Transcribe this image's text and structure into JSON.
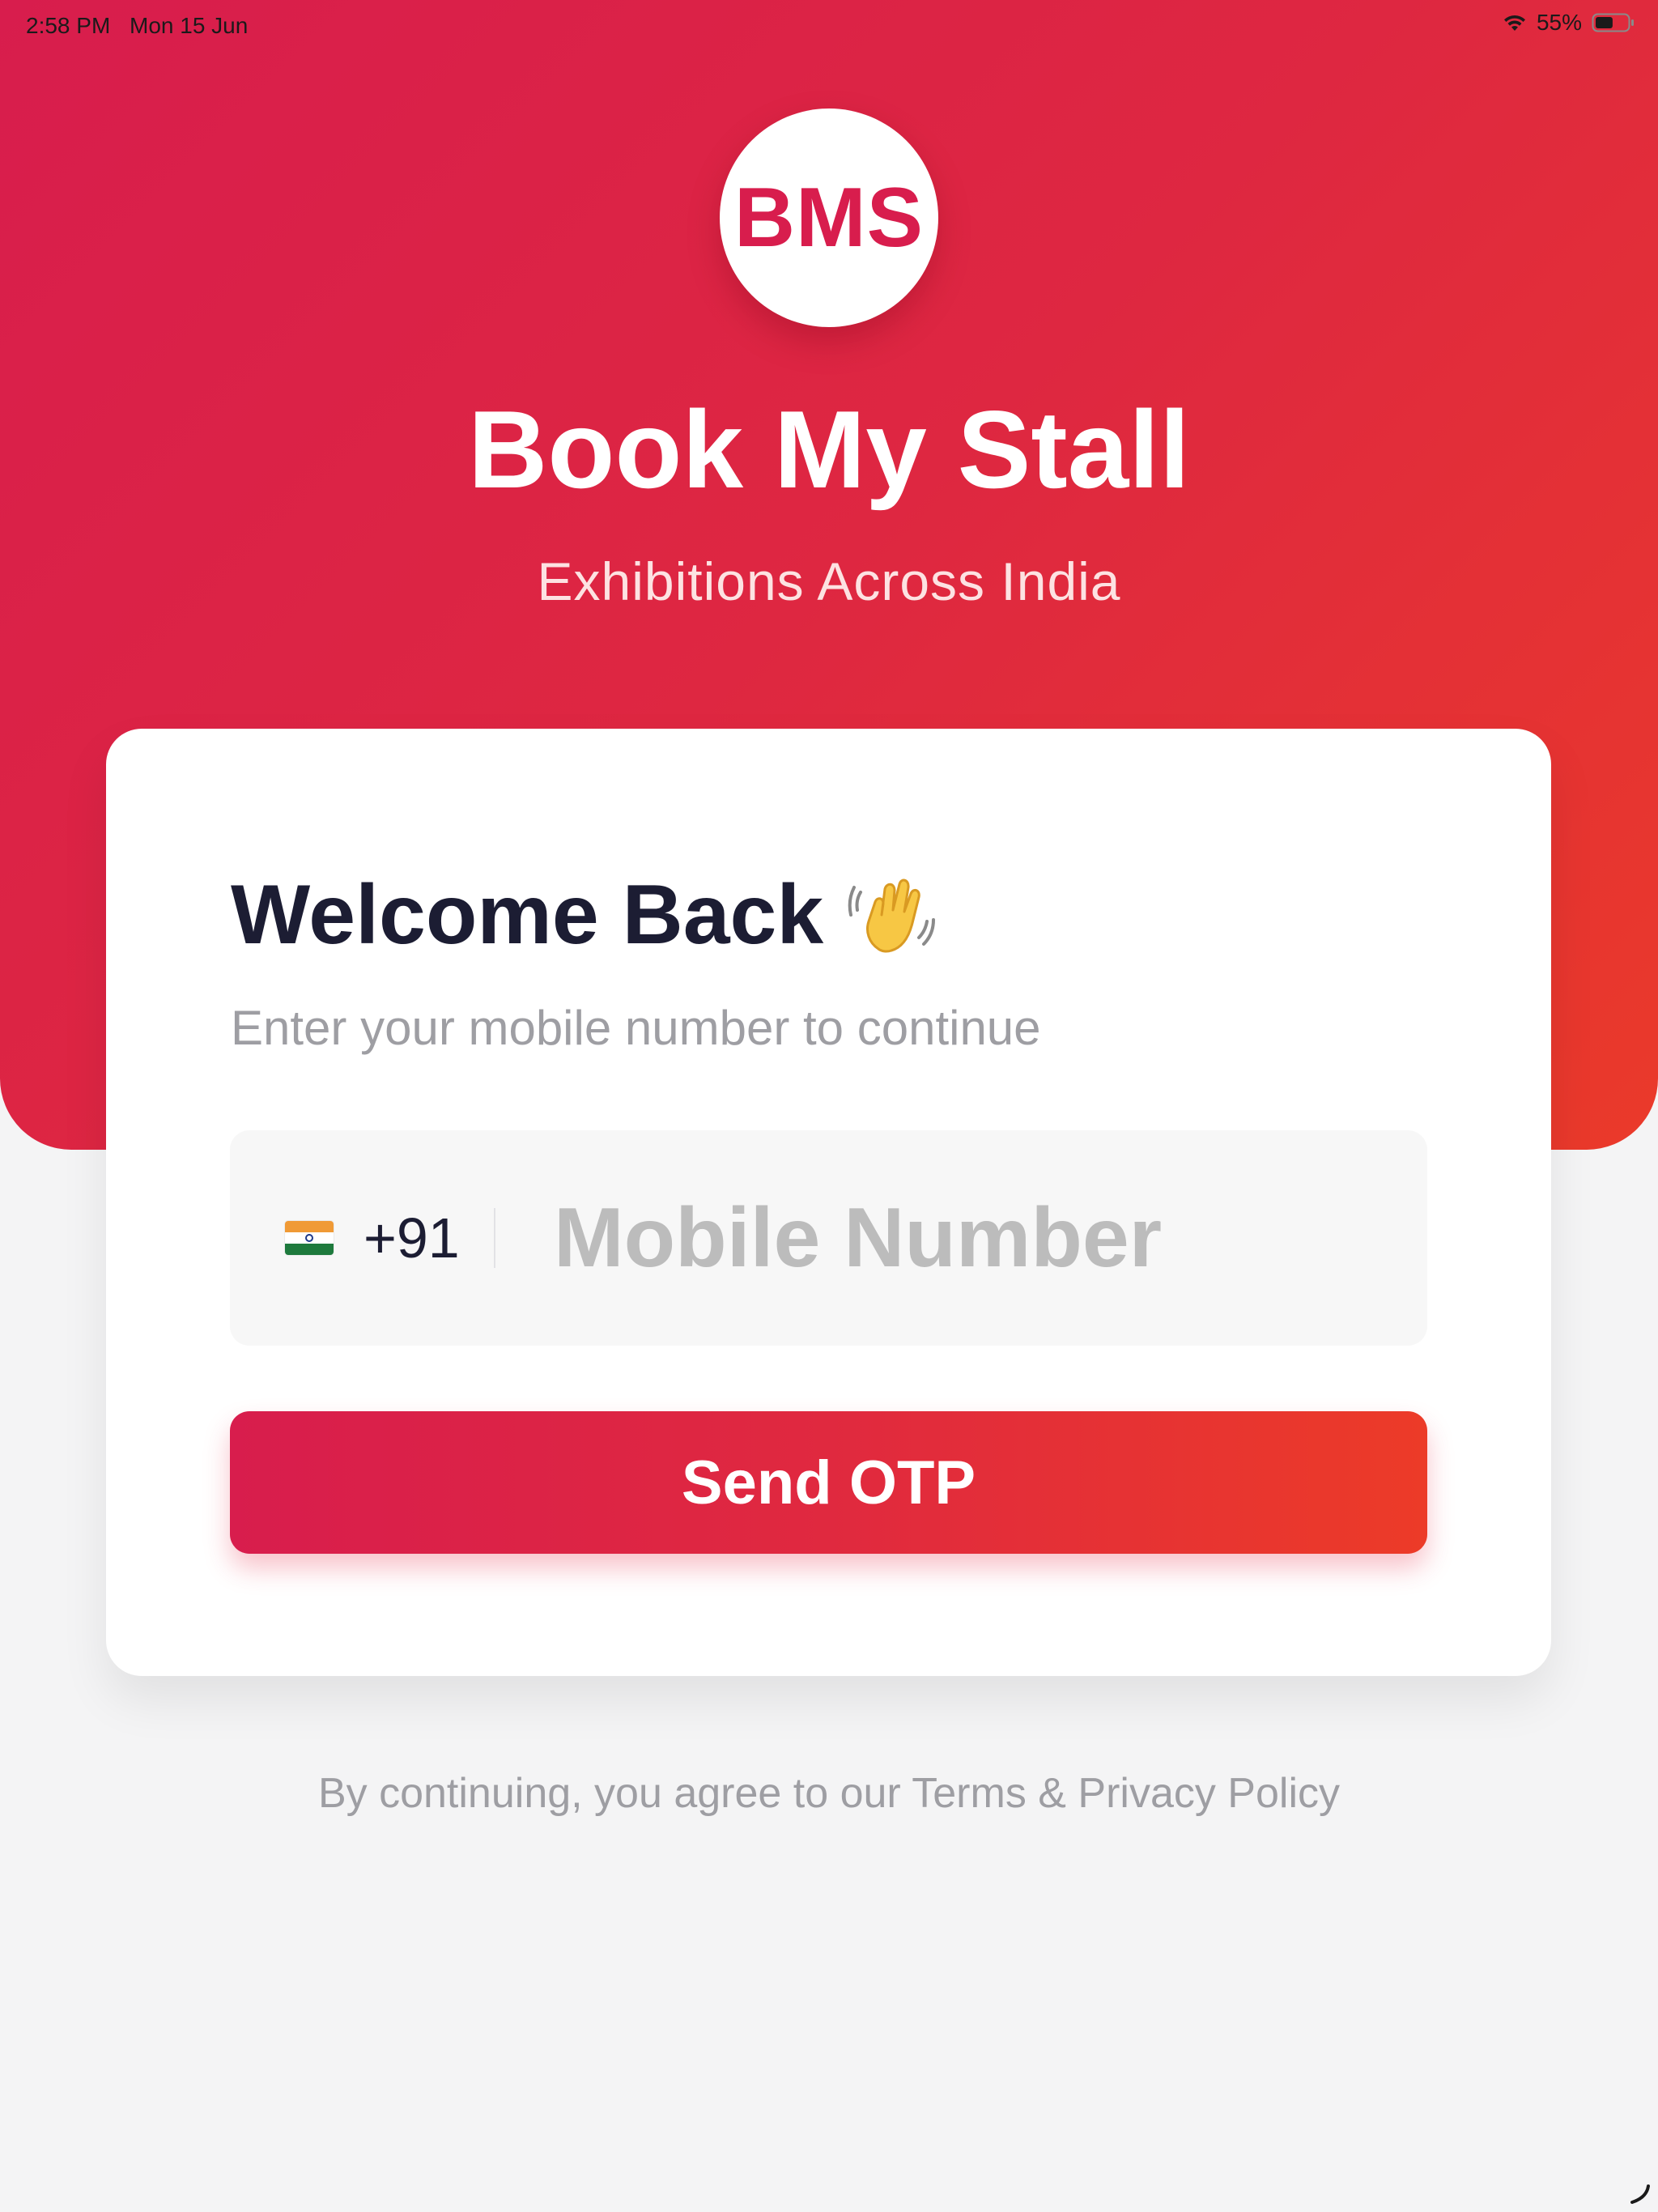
{
  "status_bar": {
    "time": "2:58 PM",
    "date": "Mon 15 Jun",
    "battery_percent": "55%",
    "battery_level": 0.55,
    "wifi_icon": "wifi-icon",
    "battery_icon": "battery-icon"
  },
  "header": {
    "logo_text": "BMS",
    "title": "Book My Stall",
    "subtitle": "Exhibitions Across India"
  },
  "login": {
    "welcome_title": "Welcome Back",
    "wave_icon": "waving-hand-icon",
    "instruction": "Enter your mobile number to continue",
    "country_flag_icon": "india-flag-icon",
    "country_code": "+91",
    "mobile_value": "",
    "mobile_placeholder": "Mobile Number",
    "send_button_label": "Send OTP"
  },
  "footer": {
    "terms_text": "By continuing, you agree to our Terms & Privacy Policy"
  },
  "colors": {
    "brand_primary": "#d81d4d",
    "brand_secondary": "#ea3a2a",
    "title_dark": "#1c1d33",
    "muted_text": "#9e9ea3",
    "background": "#f4f4f5"
  }
}
